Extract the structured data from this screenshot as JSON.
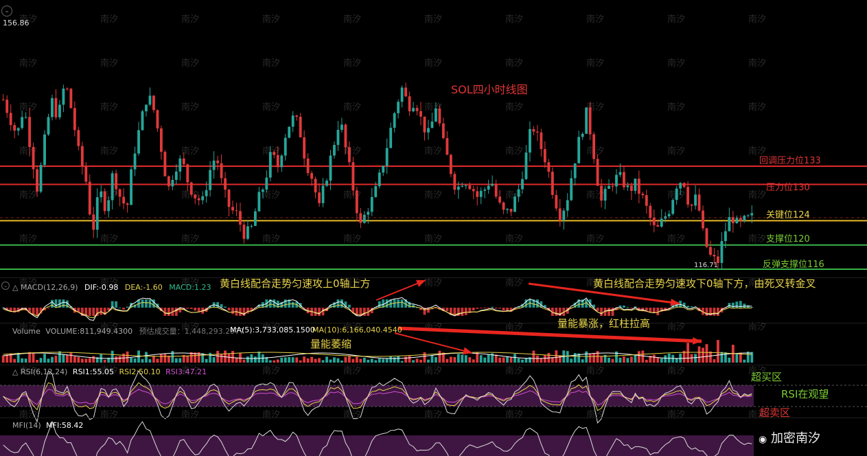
{
  "header": {
    "price_top": "156.86"
  },
  "title": "SOL四小时线图",
  "watermark": {
    "text": "南汐",
    "bottom_right": "加密南汐"
  },
  "levels": [
    {
      "label": "回调压力位133",
      "value": 133,
      "color": "#e02a2a",
      "label_color": "#e03535"
    },
    {
      "label": "压力位130",
      "value": 130,
      "color": "#e02a2a",
      "label_color": "#e03535"
    },
    {
      "label": "关键位124",
      "value": 124,
      "color": "#e8b923",
      "label_color": "#e8d44a"
    },
    {
      "label": "支撑位120",
      "value": 120,
      "color": "#37b34a",
      "label_color": "#7acc34"
    },
    {
      "label": "反弹支撑位116",
      "value": 116,
      "color": "#37b34a",
      "label_color": "#7acc34"
    }
  ],
  "low_label": "116.71",
  "macd": {
    "name": "MACD(12,26,9)",
    "dif_label": "DIF:-0.98",
    "dea_label": "DEA:-1.60",
    "macd_label": "MACD:1.23",
    "note_left": "黄白线配合走势匀速攻上0轴上方",
    "note_right": "黄白线配合走势匀速攻下0轴下方，由死叉转金叉"
  },
  "volume": {
    "name": "Volume",
    "vol_label": "VOLUME:811,949.4300",
    "est_label": "预估成交量：1,448,293.2977",
    "ma5_label": "MA(5):3,733,085.1500",
    "ma10_label": "MA(10):6,166,040.4540",
    "note_surge": "量能暴涨，红柱拉高",
    "note_shrink": "量能萎缩"
  },
  "rsi": {
    "name": "RSI(6,12,24)",
    "rsi1_label": "RSI1:55.05",
    "rsi2_label": "RSI2:50.10",
    "rsi3_label": "RSI3:47.21",
    "note_overbought": "超买区",
    "note_watch": "RSI在观望",
    "note_oversold": "超卖区"
  },
  "mfi": {
    "name": "MFI(14)",
    "value_label": "MFI:58.42"
  },
  "chart_data": {
    "type": "candlestick",
    "title": "SOL四小时线图",
    "y_max_label": 156.86,
    "y_min_label": 116.71,
    "price_path": [
      144,
      141,
      138,
      143,
      136,
      129,
      137,
      144,
      141,
      147,
      142,
      135,
      131,
      122,
      129,
      126,
      132,
      128,
      126,
      135,
      140,
      145,
      142,
      136,
      129,
      133,
      134,
      130,
      128,
      127,
      132,
      135,
      129,
      126,
      125,
      122,
      122,
      127,
      130,
      135,
      133,
      138,
      141,
      140,
      134,
      131,
      126,
      131,
      136,
      141,
      135,
      129,
      123,
      126,
      128,
      132,
      137,
      142,
      146,
      143,
      144,
      140,
      138,
      143,
      137,
      133,
      129,
      131,
      130,
      128,
      129,
      131,
      127,
      125,
      126,
      129,
      134,
      140,
      137,
      134,
      129,
      125,
      127,
      133,
      138,
      142,
      135,
      127,
      129,
      131,
      131,
      129,
      130,
      128,
      125,
      122,
      124,
      126,
      130,
      131,
      126,
      128,
      121,
      118,
      117,
      122,
      125,
      123,
      124,
      124.5
    ],
    "horizontal_levels": [
      133,
      130,
      124,
      120,
      116
    ]
  }
}
